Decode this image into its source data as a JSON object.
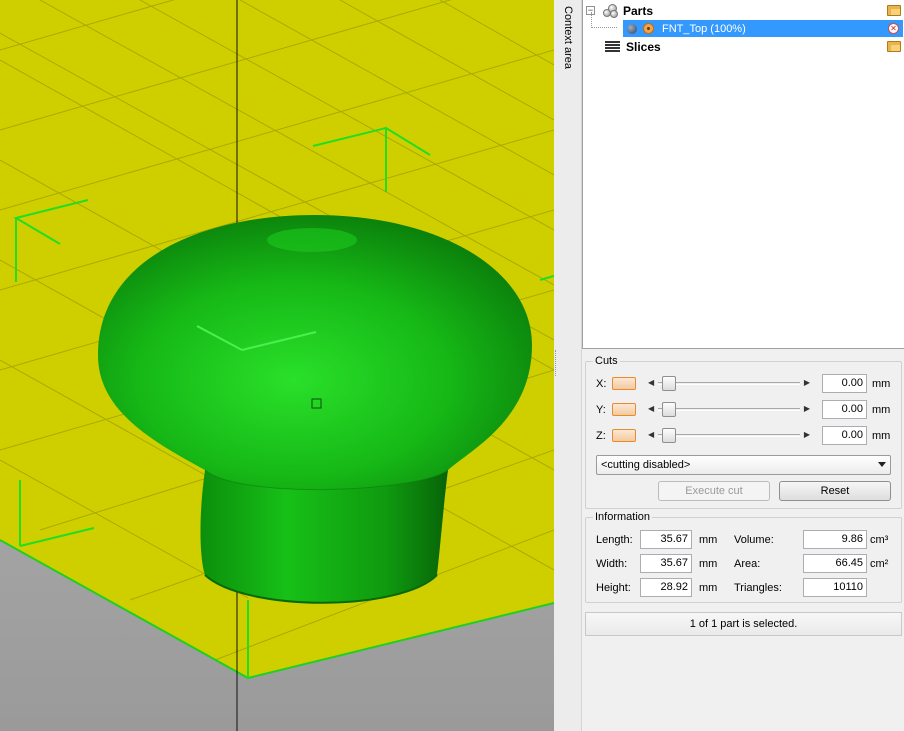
{
  "side_panel": {
    "context_label": "Context area"
  },
  "tree": {
    "parts_label": "Parts",
    "part_item_label": "FNT_Top (100%)",
    "slices_label": "Slices",
    "expander_symbol": "−"
  },
  "cuts": {
    "title": "Cuts",
    "axes": [
      {
        "label": "X:",
        "value": "0.00",
        "unit": "mm"
      },
      {
        "label": "Y:",
        "value": "0.00",
        "unit": "mm"
      },
      {
        "label": "Z:",
        "value": "0.00",
        "unit": "mm"
      }
    ],
    "mode_selected": "<cutting disabled>",
    "execute_label": "Execute cut",
    "reset_label": "Reset"
  },
  "info": {
    "title": "Information",
    "length_label": "Length:",
    "length_value": "35.67",
    "length_unit": "mm",
    "width_label": "Width:",
    "width_value": "35.67",
    "width_unit": "mm",
    "height_label": "Height:",
    "height_value": "28.92",
    "height_unit": "mm",
    "volume_label": "Volume:",
    "volume_value": "9.86",
    "volume_unit": "cm³",
    "area_label": "Area:",
    "area_value": "66.45",
    "area_unit": "cm²",
    "triangles_label": "Triangles:",
    "triangles_value": "10110"
  },
  "status": {
    "text": "1 of 1 part is selected."
  },
  "colors": {
    "platform": "#cfcf00",
    "grid": "#9a9a00",
    "model": "#14c414",
    "axis_marker": "#22dd22",
    "selection": "#3399ff"
  },
  "icons": {
    "parts": "parts-cluster-icon",
    "folder": "open-folder-icon",
    "close": "close-icon",
    "eye": "visibility-icon",
    "slices": "slices-icon"
  }
}
